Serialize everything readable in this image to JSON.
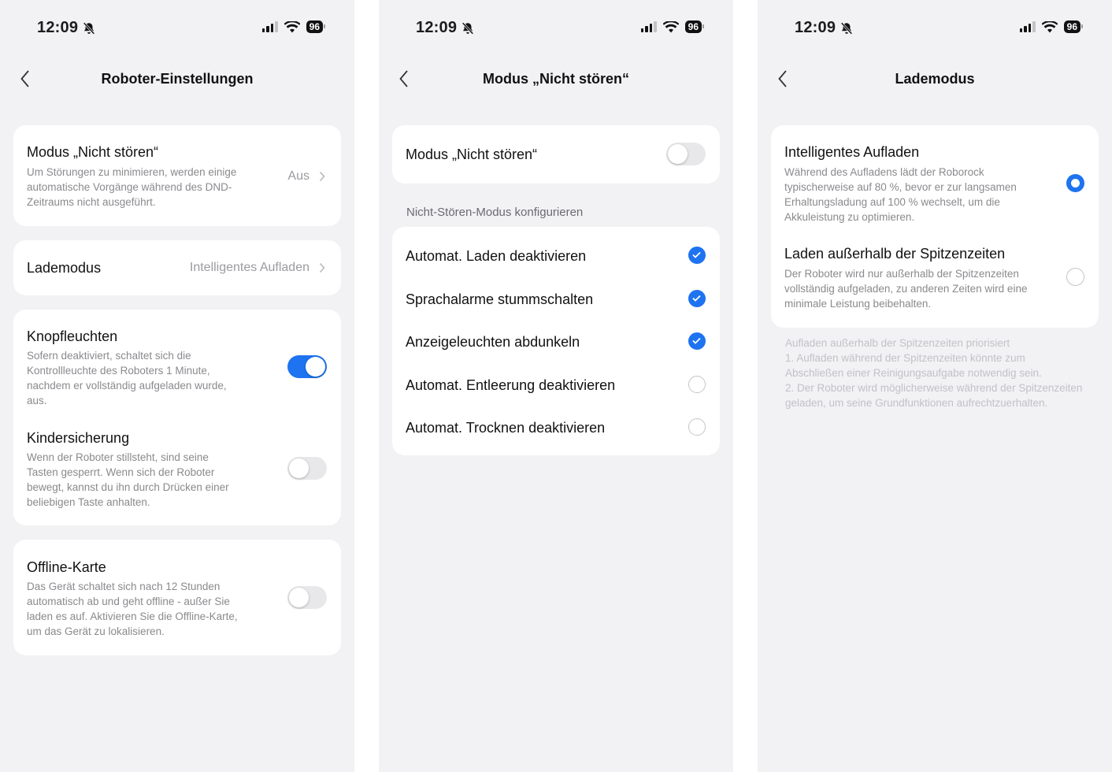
{
  "status": {
    "time": "12:09",
    "battery": "96"
  },
  "screen1": {
    "title": "Roboter-Einstellungen",
    "dnd": {
      "title": "Modus „Nicht stören“",
      "desc": "Um Störungen zu minimieren, werden einige automatische Vorgänge während des DND-Zeitraums nicht ausgeführt.",
      "value": "Aus"
    },
    "charge": {
      "title": "Lademodus",
      "value": "Intelligentes Aufladen"
    },
    "buttonlight": {
      "title": "Knopfleuchten",
      "desc": "Sofern deaktiviert, schaltet sich die Kontrollleuchte des Roboters 1 Minute, nachdem er vollständig aufgeladen wurde, aus.",
      "on": true
    },
    "childlock": {
      "title": "Kindersicherung",
      "desc": "Wenn der Roboter stillsteht, sind seine Tasten gesperrt. Wenn sich der Roboter bewegt, kannst du ihn durch Drücken einer beliebigen Taste anhalten.",
      "on": false
    },
    "offline": {
      "title": "Offline-Karte",
      "desc": "Das Gerät schaltet sich nach 12 Stunden automatisch ab und geht offline - außer Sie laden es auf. Aktivieren Sie die Offline-Karte, um das Gerät zu lokalisieren.",
      "on": false
    }
  },
  "screen2": {
    "title": "Modus „Nicht stören“",
    "dnd_toggle": {
      "label": "Modus „Nicht stören“",
      "on": false
    },
    "section": "Nicht-Stören-Modus konfigurieren",
    "options": [
      {
        "label": "Automat. Laden deaktivieren",
        "checked": true
      },
      {
        "label": "Sprachalarme stummschalten",
        "checked": true
      },
      {
        "label": "Anzeigeleuchten abdunkeln",
        "checked": true
      },
      {
        "label": "Automat. Entleerung deaktivieren",
        "checked": false
      },
      {
        "label": "Automat. Trocknen deaktivieren",
        "checked": false
      }
    ]
  },
  "screen3": {
    "title": "Lademodus",
    "options": [
      {
        "title": "Intelligentes Aufladen",
        "desc": "Während des Aufladens lädt der Roborock typischerweise auf 80 %, bevor er zur langsamen Erhaltungsladung auf 100 % wechselt, um die Akkuleistung zu optimieren.",
        "selected": true
      },
      {
        "title": "Laden außerhalb der Spitzenzeiten",
        "desc": "Der Roboter wird nur außerhalb der Spitzenzeiten vollständig aufgeladen, zu anderen Zeiten wird eine minimale Leistung beibehalten.",
        "selected": false
      }
    ],
    "note": [
      "Aufladen außerhalb der Spitzenzeiten priorisiert",
      "1. Aufladen während der Spitzenzeiten könnte zum Abschließen einer Reinigungsaufgabe notwendig sein.",
      "2. Der Roboter wird möglicherweise während der Spitzenzeiten geladen, um seine Grundfunktionen aufrechtzuerhalten."
    ]
  }
}
